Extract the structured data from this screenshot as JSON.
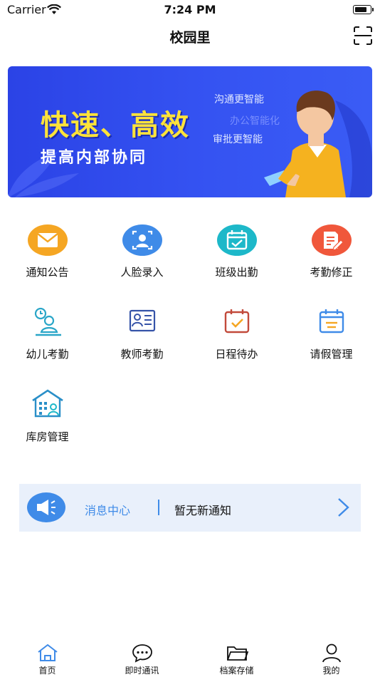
{
  "status_bar": {
    "carrier": "Carrier",
    "time": "7:24 PM",
    "battery_level": 0.8
  },
  "nav": {
    "title": "校园里",
    "scan_icon": "scan-icon"
  },
  "banner": {
    "headline": "快速、高效",
    "subline": "提高内部协同",
    "tagline_1": "沟通更智能",
    "tagline_2": "办公智能化",
    "tagline_3": "审批更智能"
  },
  "grid": [
    {
      "label": "通知公告",
      "icon": "envelope-icon",
      "color": "#f5a623"
    },
    {
      "label": "人脸录入",
      "icon": "face-id-icon",
      "color": "#3f8be8"
    },
    {
      "label": "班级出勤",
      "icon": "calendar-check-icon",
      "color": "#1db8c9"
    },
    {
      "label": "考勤修正",
      "icon": "edit-document-icon",
      "color": "#f0573b"
    },
    {
      "label": "幼儿考勤",
      "icon": "child-clock-icon",
      "color": "#2aa6c8"
    },
    {
      "label": "教师考勤",
      "icon": "teacher-card-icon",
      "color": "#3553a8"
    },
    {
      "label": "日程待办",
      "icon": "calendar-todo-icon",
      "color": "#c24a3b"
    },
    {
      "label": "请假管理",
      "icon": "leave-calendar-icon",
      "color": "#3f8be8"
    },
    {
      "label": "库房管理",
      "icon": "warehouse-icon",
      "color": "#2a8fc8"
    }
  ],
  "notice": {
    "title": "消息中心",
    "text": "暂无新通知"
  },
  "tabs": [
    {
      "label": "首页",
      "icon": "home-icon"
    },
    {
      "label": "即时通讯",
      "icon": "chat-icon"
    },
    {
      "label": "档案存储",
      "icon": "folder-icon"
    },
    {
      "label": "我的",
      "icon": "user-icon"
    }
  ],
  "colors": {
    "accent": "#3f8be8",
    "banner_bg": "#3553f2",
    "headline": "#ffe33a",
    "notice_bg": "#e9f0fb"
  }
}
